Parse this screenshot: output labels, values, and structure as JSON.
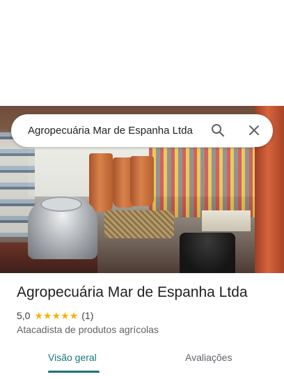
{
  "search": {
    "query": "Agropecuária Mar de Espanha Ltda",
    "search_icon": "search-icon",
    "close_icon": "close-icon"
  },
  "place": {
    "name": "Agropecuária Mar de Espanha Ltda",
    "rating": "5,0",
    "stars": [
      "★",
      "★",
      "★",
      "★",
      "★"
    ],
    "review_count": "(1)",
    "category": "Atacadista de produtos agrícolas",
    "photo": "store-interior-photo"
  },
  "tabs": {
    "overview": "Visão geral",
    "reviews": "Avaliações",
    "active": "overview"
  },
  "colors": {
    "accent": "#1a7377",
    "star": "#f6b100",
    "text_primary": "#202124",
    "text_secondary": "#5f6368"
  }
}
